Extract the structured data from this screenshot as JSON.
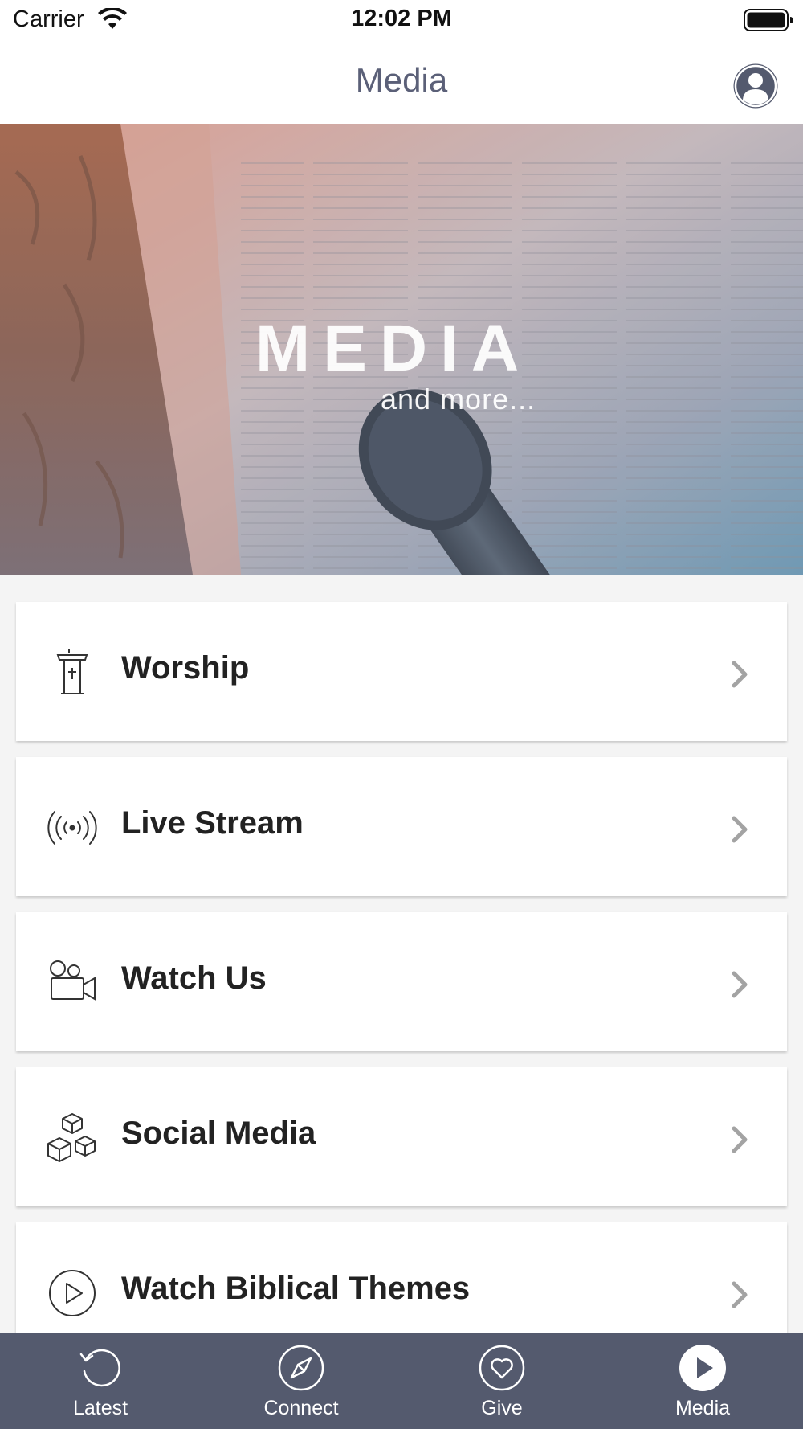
{
  "status_bar": {
    "carrier": "Carrier",
    "time": "12:02 PM",
    "wifi_icon": "wifi-icon",
    "battery_icon": "battery-icon"
  },
  "nav": {
    "title": "Media",
    "profile_icon": "person-circle-icon"
  },
  "hero": {
    "title": "MEDIA",
    "subtitle": "and more..."
  },
  "menu": {
    "items": [
      {
        "label": "Worship",
        "icon": "pulpit-icon"
      },
      {
        "label": "Live Stream",
        "icon": "broadcast-icon"
      },
      {
        "label": "Watch Us",
        "icon": "video-camera-icon"
      },
      {
        "label": "Social Media",
        "icon": "cubes-icon"
      },
      {
        "label": "Watch Biblical Themes",
        "icon": "play-circle-icon"
      }
    ]
  },
  "tabs": [
    {
      "label": "Latest",
      "icon": "history-icon",
      "active": false
    },
    {
      "label": "Connect",
      "icon": "compass-icon",
      "active": false
    },
    {
      "label": "Give",
      "icon": "heart-icon",
      "active": false
    },
    {
      "label": "Media",
      "icon": "play-icon",
      "active": true
    }
  ],
  "colors": {
    "tab_bar": "#545a6e",
    "nav_title": "#5b6078",
    "menu_text": "#222222"
  }
}
